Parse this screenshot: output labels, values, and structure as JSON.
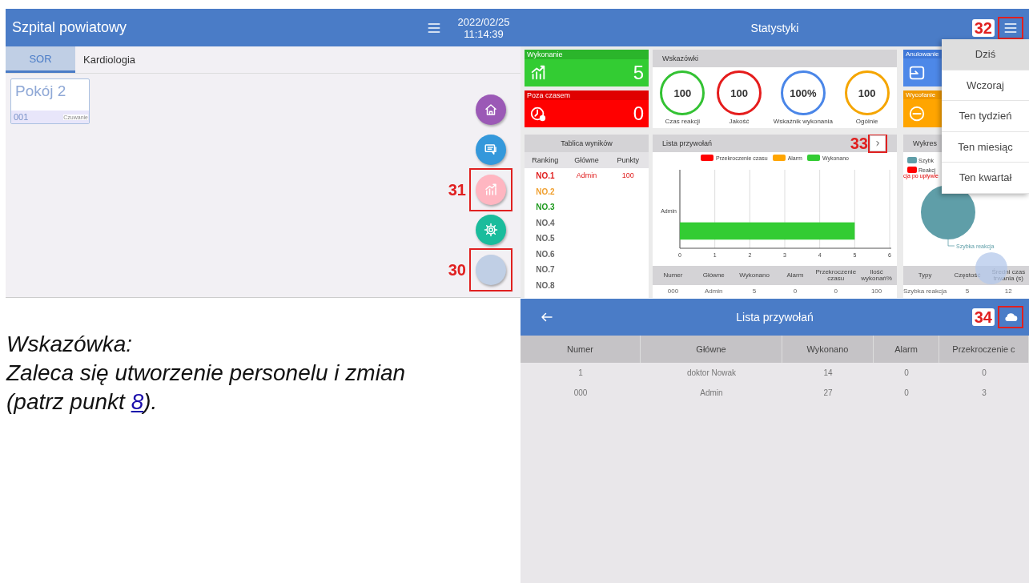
{
  "room_app": {
    "title": "Szpital powiatowy",
    "date": "2022/02/25",
    "time": "11:14:39",
    "tabs": [
      {
        "label": "SOR",
        "selected": true
      },
      {
        "label": "Kardiologia",
        "selected": false
      }
    ],
    "rooms": [
      {
        "name": "Pokój 2",
        "number": "001",
        "status": "Czuwanie"
      }
    ],
    "fab_buttons": [
      {
        "kind": "home"
      },
      {
        "kind": "chat"
      },
      {
        "kind": "stats",
        "callout": "31"
      },
      {
        "kind": "gear"
      },
      {
        "kind": "blank",
        "callout": "30"
      }
    ]
  },
  "stats_app": {
    "title": "Statystyki",
    "menu_callout": "32",
    "summary_cards": [
      {
        "kind": "done",
        "title": "Wykonanie",
        "value": "5"
      },
      {
        "kind": "overdue",
        "title": "Poza czasem",
        "value": "0"
      }
    ],
    "indicators": {
      "title": "Wskazówki",
      "rings": [
        {
          "value": "100",
          "label": "Czas reakcji",
          "color": "#33c233"
        },
        {
          "value": "100",
          "label": "Jakość",
          "color": "#e51c1c"
        },
        {
          "value": "100%",
          "label": "Wskaźnik wykonania",
          "color": "#4a86e8"
        },
        {
          "value": "100",
          "label": "Ogólnie",
          "color": "#f5a500"
        }
      ]
    },
    "side_cards": [
      {
        "kind": "cancel",
        "title": "Anulowanie"
      },
      {
        "kind": "withdraw",
        "title": "Wycofanie"
      }
    ],
    "leaderboard": {
      "title": "Tablica wyników",
      "columns": [
        "Ranking",
        "Główne",
        "Punkty"
      ],
      "rows": [
        {
          "rank": "NO.1",
          "name": "Admin",
          "points": "100",
          "color": "#e02020"
        },
        {
          "rank": "NO.2",
          "color": "#f0a030"
        },
        {
          "rank": "NO.3",
          "color": "#1e9a1e"
        },
        {
          "rank": "NO.4",
          "color": "#666666"
        },
        {
          "rank": "NO.5",
          "color": "#666666"
        },
        {
          "rank": "NO.6",
          "color": "#666666"
        },
        {
          "rank": "NO.7",
          "color": "#666666"
        },
        {
          "rank": "NO.8",
          "color": "#666666"
        }
      ]
    },
    "call_list": {
      "title": "Lista przywołań",
      "callout": "33",
      "chart_data": {
        "type": "bar",
        "orientation": "horizontal",
        "stacked": true,
        "categories": [
          "Admin"
        ],
        "series": [
          {
            "name": "Przekroczenie czasu",
            "color": "#ff0000",
            "values": [
              0
            ]
          },
          {
            "name": "Alarm",
            "color": "#ffa500",
            "values": [
              0
            ]
          },
          {
            "name": "Wykonano",
            "color": "#33cc33",
            "values": [
              5
            ]
          }
        ],
        "xlim": [
          0,
          6
        ],
        "xticks": [
          0,
          1,
          2,
          3,
          4,
          5,
          6
        ],
        "grid": true
      },
      "columns": [
        "Numer",
        "Główne",
        "Wykonano",
        "Alarm",
        "Przekroczenie czasu",
        "Ilość wykonań%"
      ],
      "rows": [
        [
          "000",
          "Admin",
          "5",
          "0",
          "0",
          "100"
        ]
      ]
    },
    "type_chart": {
      "title": "Wykres",
      "legend": [
        {
          "label": "Szybk",
          "color": "#5f9ea8"
        },
        {
          "label": "Reakcj",
          "color": "#ff0000"
        }
      ],
      "note": "cja po upływie",
      "slice_label": "Szybka reakcja",
      "columns": [
        "Typy",
        "Częstość",
        "Średni czas trwania (s)"
      ],
      "rows": [
        [
          "Szybka reakcja",
          "5",
          "12"
        ]
      ]
    },
    "period_menu": [
      {
        "label": "Dziś",
        "selected": true
      },
      {
        "label": "Wczoraj",
        "selected": false
      },
      {
        "label": "Ten tydzień",
        "selected": false
      },
      {
        "label": "Ten miesiąc",
        "selected": false
      },
      {
        "label": "Ten kwartał",
        "selected": false
      }
    ]
  },
  "note": {
    "title": "Wskazówka:",
    "text": "Zaleca się utworzenie personelu i zmian (patrz punkt ",
    "link": "8",
    "text_after": ")."
  },
  "call_list_app": {
    "title": "Lista przywołań",
    "callout": "34",
    "columns": [
      "Numer",
      "Główne",
      "Wykonano",
      "Alarm",
      "Przekroczenie c"
    ],
    "rows": [
      [
        "1",
        "doktor Nowak",
        "14",
        "0",
        "0"
      ],
      [
        "000",
        "Admin",
        "27",
        "0",
        "3"
      ]
    ]
  }
}
